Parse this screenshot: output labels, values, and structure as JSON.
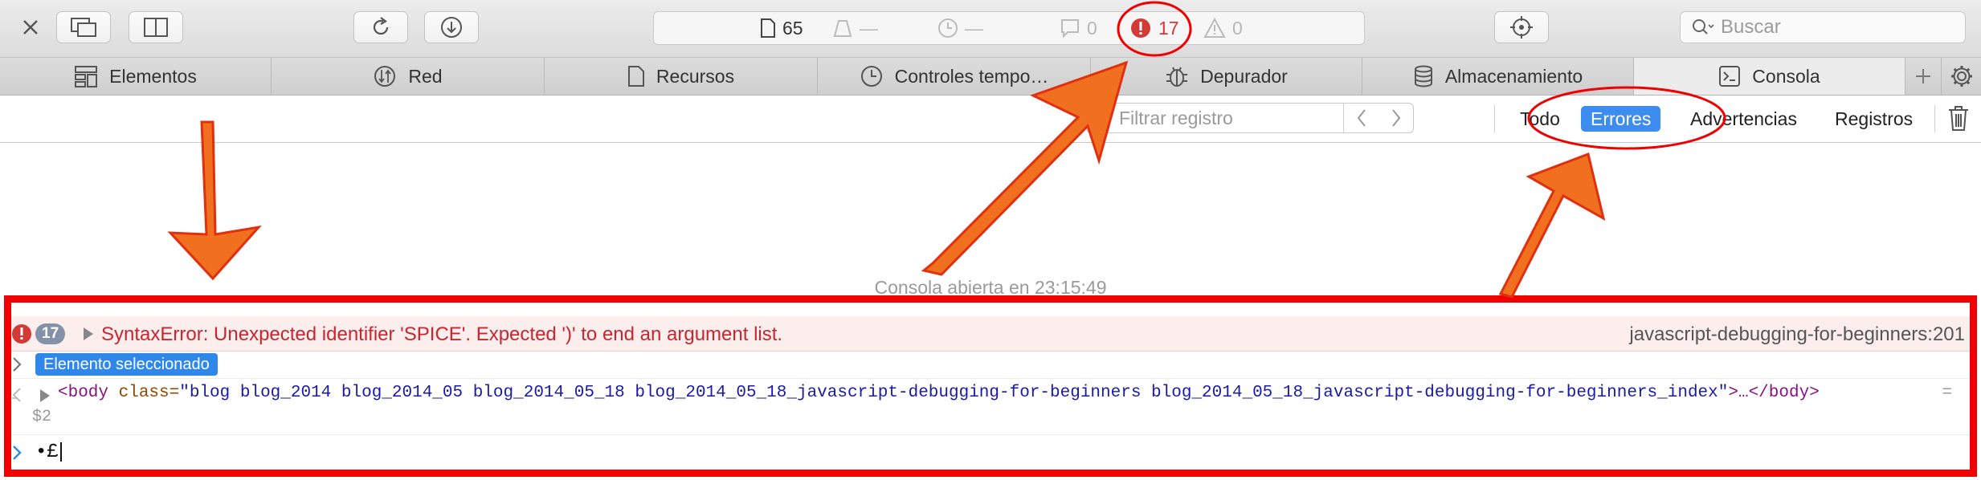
{
  "toolbar": {
    "resources_count": "65",
    "dim_dash_1": "—",
    "dim_dash_2": "—",
    "log_count": "0",
    "error_count": "17",
    "warning_count": "0",
    "search_placeholder": "Buscar"
  },
  "tabs": [
    {
      "label": "Elementos",
      "icon": "elements-icon"
    },
    {
      "label": "Red",
      "icon": "network-icon"
    },
    {
      "label": "Recursos",
      "icon": "resources-icon"
    },
    {
      "label": "Controles tempo…",
      "icon": "timelines-icon"
    },
    {
      "label": "Depurador",
      "icon": "debugger-icon"
    },
    {
      "label": "Almacenamiento",
      "icon": "storage-icon"
    },
    {
      "label": "Consola",
      "icon": "console-icon",
      "active": true
    }
  ],
  "filter": {
    "placeholder": "Filtrar registro",
    "buttons": [
      "Todo",
      "Errores",
      "Advertencias",
      "Registros"
    ],
    "active": "Errores"
  },
  "console": {
    "opened_text": "Consola abierta en 23:15:49",
    "error": {
      "count": "17",
      "message": "SyntaxError: Unexpected identifier 'SPICE'. Expected ')' to end an argument list.",
      "source": "javascript-debugging-for-beginners:201"
    },
    "selected_label": "Elemento seleccionado",
    "body_tag_open": "<body",
    "body_attr": "class=",
    "body_class": "\"blog blog_2014 blog_2014_05 blog_2014_05_18 blog_2014_05_18_javascript-debugging-for-beginners blog_2014_05_18_javascript-debugging-for-beginners_index\"",
    "body_tag_close": ">…</body>",
    "equals": "=",
    "ref": "$2",
    "prompt_input": "•£"
  },
  "colors": {
    "accent": "#3d8cf0",
    "error": "#c8262f",
    "annotation_red": "#f00000",
    "arrow_orange": "#f07020"
  }
}
